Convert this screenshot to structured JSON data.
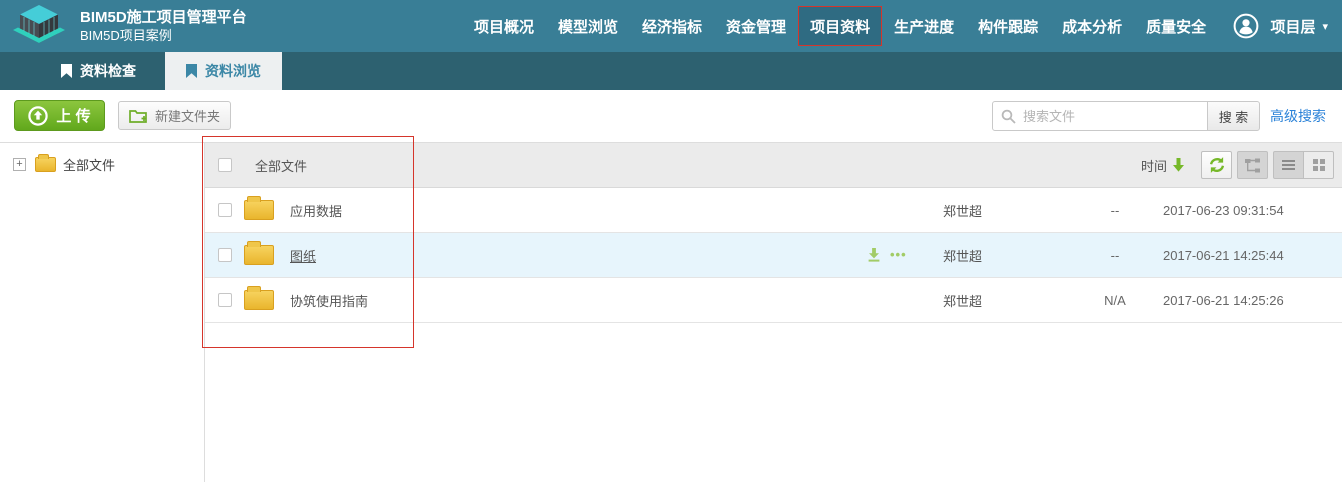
{
  "colors": {
    "topbar_bg": "#397e96",
    "tabbar_bg": "#2d6170",
    "active_nav_bg": "#2f6b82",
    "active_tab_bg": "#edf0f1",
    "active_tab_text": "#3b87a6",
    "accent_green": "#76b829",
    "upload_green": "#6fb52d",
    "link_blue": "#2a82d8",
    "row_hover_blue": "#e7f5fc",
    "folder_yellow": "#eebc3a",
    "annotation_red": "#d5352b"
  },
  "header": {
    "title": "BIM5D施工项目管理平台",
    "subtitle": "BIM5D项目案例",
    "nav": [
      {
        "label": "项目概况",
        "active": false
      },
      {
        "label": "模型浏览",
        "active": false
      },
      {
        "label": "经济指标",
        "active": false
      },
      {
        "label": "资金管理",
        "active": false
      },
      {
        "label": "项目资料",
        "active": true
      },
      {
        "label": "生产进度",
        "active": false
      },
      {
        "label": "构件跟踪",
        "active": false
      },
      {
        "label": "成本分析",
        "active": false
      },
      {
        "label": "质量安全",
        "active": false
      }
    ],
    "user_label": "项目层",
    "caret": "▾"
  },
  "tabs": [
    {
      "label": "资料检查",
      "active": false
    },
    {
      "label": "资料浏览",
      "active": true
    }
  ],
  "toolbar": {
    "upload_label": "上 传",
    "new_folder_label": "新建文件夹",
    "search_placeholder": "搜索文件",
    "search_button": "搜 索",
    "advanced_search": "高级搜索"
  },
  "sidebar": {
    "root_label": "全部文件",
    "expander_glyph": "+"
  },
  "table": {
    "select_all_label": "全部文件",
    "sort": {
      "label": "时间",
      "direction": "desc"
    },
    "more_icon_glyph": "•••",
    "rows": [
      {
        "name": "应用数据",
        "owner": "郑世超",
        "size": "--",
        "time": "2017-06-23 09:31:54"
      },
      {
        "name": "图纸",
        "owner": "郑世超",
        "size": "--",
        "time": "2017-06-21 14:25:44"
      },
      {
        "name": "协筑使用指南",
        "owner": "郑世超",
        "size": "N/A",
        "time": "2017-06-21 14:25:26"
      }
    ]
  }
}
